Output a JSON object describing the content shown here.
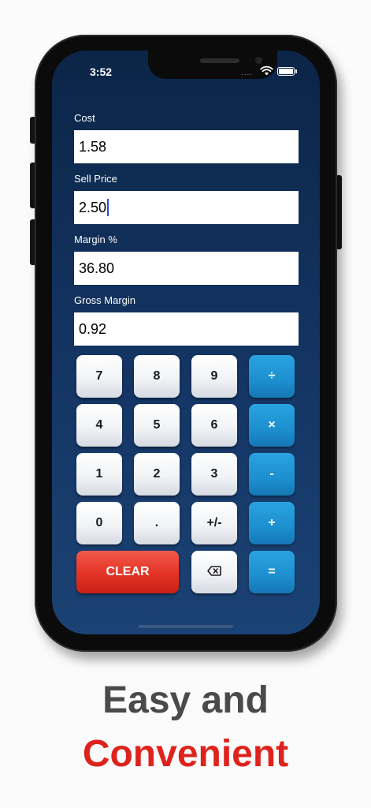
{
  "status_bar": {
    "time": "3:52",
    "signal": "....",
    "wifi_icon": "wifi-icon",
    "battery_icon": "battery-icon"
  },
  "form": {
    "cost_label": "Cost",
    "cost_value": "1.58",
    "sell_price_label": "Sell Price",
    "sell_price_value": "2.50",
    "margin_label": "Margin %",
    "margin_value": "36.80",
    "gross_margin_label": "Gross Margin",
    "gross_margin_value": "0.92"
  },
  "keypad": {
    "row1": [
      "7",
      "8",
      "9",
      "÷"
    ],
    "row2": [
      "4",
      "5",
      "6",
      "×"
    ],
    "row3": [
      "1",
      "2",
      "3",
      "-"
    ],
    "row4": [
      "0",
      ".",
      "+/-",
      "+"
    ],
    "clear": "CLEAR",
    "backspace_icon": "backspace-icon",
    "equals": "="
  },
  "tagline": {
    "line1": "Easy and",
    "line2": "Convenient"
  },
  "colors": {
    "screen_background": "#143564",
    "operator_key": "#1d8fcf",
    "clear_key": "#e33326",
    "tagline_dark": "#4a4a4a",
    "tagline_red": "#de231d"
  }
}
